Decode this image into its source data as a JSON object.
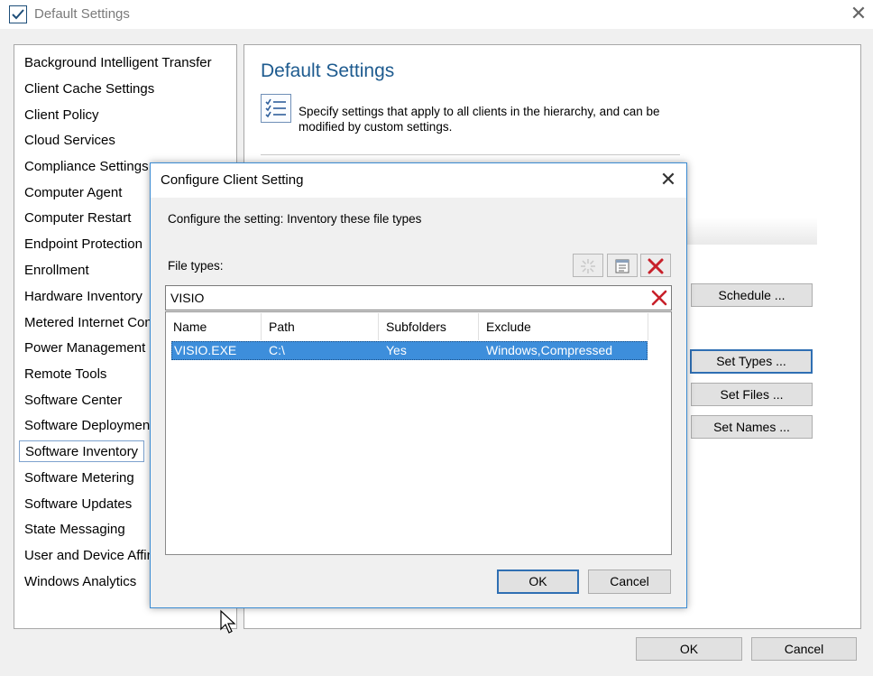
{
  "window": {
    "title": "Default Settings",
    "close_glyph": "✕",
    "icon": "checklist-window-icon"
  },
  "sidebar": {
    "items": [
      {
        "label": "Background Intelligent Transfer",
        "selected": false
      },
      {
        "label": "Client Cache Settings",
        "selected": false
      },
      {
        "label": "Client Policy",
        "selected": false
      },
      {
        "label": "Cloud Services",
        "selected": false
      },
      {
        "label": "Compliance Settings",
        "selected": false
      },
      {
        "label": "Computer Agent",
        "selected": false
      },
      {
        "label": "Computer Restart",
        "selected": false
      },
      {
        "label": "Endpoint Protection",
        "selected": false
      },
      {
        "label": "Enrollment",
        "selected": false
      },
      {
        "label": "Hardware Inventory",
        "selected": false
      },
      {
        "label": "Metered Internet Con",
        "selected": false
      },
      {
        "label": "Power Management",
        "selected": false
      },
      {
        "label": "Remote Tools",
        "selected": false
      },
      {
        "label": "Software Center",
        "selected": false
      },
      {
        "label": "Software Deployment",
        "selected": false
      },
      {
        "label": "Software Inventory",
        "selected": true
      },
      {
        "label": "Software Metering",
        "selected": false
      },
      {
        "label": "Software Updates",
        "selected": false
      },
      {
        "label": "State Messaging",
        "selected": false
      },
      {
        "label": "User and Device Affin",
        "selected": false
      },
      {
        "label": "Windows Analytics",
        "selected": false
      }
    ]
  },
  "main": {
    "title": "Default Settings",
    "description": "Specify settings that apply to all clients in the hierarchy, and can be modified by custom settings.",
    "buttons": {
      "schedule": "Schedule ...",
      "set_types": "Set Types ...",
      "set_files": "Set Files ...",
      "set_names": "Set Names ..."
    }
  },
  "footer": {
    "ok": "OK",
    "cancel": "Cancel"
  },
  "dialog": {
    "title": "Configure Client Setting",
    "close_glyph": "✕",
    "setting_text": "Configure the setting: Inventory these file types",
    "file_types_label": "File types:",
    "filter_value": "VISIO",
    "columns": [
      "Name",
      "Path",
      "Subfolders",
      "Exclude"
    ],
    "rows": [
      {
        "name": "VISIO.EXE",
        "path": "C:\\",
        "subfolders": "Yes",
        "exclude": "Windows,Compressed",
        "selected": true
      }
    ],
    "ok": "OK",
    "cancel": "Cancel",
    "toolbar_icons": [
      "new-starburst-icon",
      "properties-icon",
      "delete-icon"
    ]
  },
  "colors": {
    "accent": "#3d8edb",
    "title_blue": "#1e5b8f",
    "delete_red": "#c8202a"
  }
}
